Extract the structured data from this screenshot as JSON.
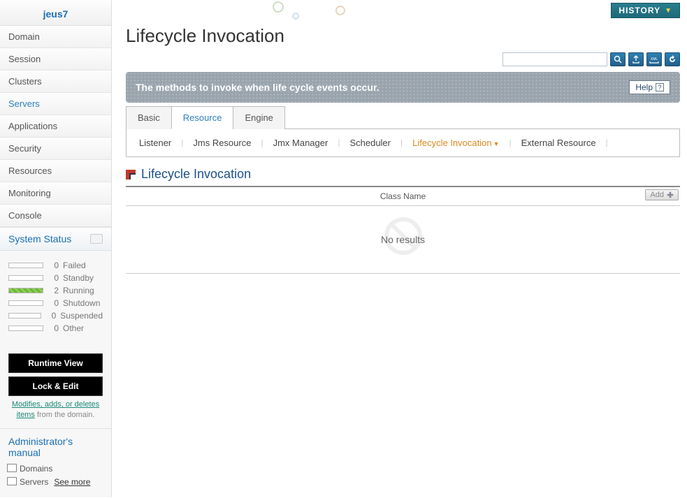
{
  "brand": "jeus7",
  "nav": {
    "items": [
      {
        "label": "Domain"
      },
      {
        "label": "Session"
      },
      {
        "label": "Clusters"
      },
      {
        "label": "Servers",
        "active": true
      },
      {
        "label": "Applications"
      },
      {
        "label": "Security"
      },
      {
        "label": "Resources"
      },
      {
        "label": "Monitoring"
      },
      {
        "label": "Console"
      }
    ]
  },
  "status": {
    "header": "System Status",
    "items": [
      {
        "count": 0,
        "label": "Failed",
        "running": false
      },
      {
        "count": 0,
        "label": "Standby",
        "running": false
      },
      {
        "count": 2,
        "label": "Running",
        "running": true
      },
      {
        "count": 0,
        "label": "Shutdown",
        "running": false
      },
      {
        "count": 0,
        "label": "Suspended",
        "running": false
      },
      {
        "count": 0,
        "label": "Other",
        "running": false
      }
    ]
  },
  "buttons": {
    "runtime": "Runtime View",
    "lock": "Lock & Edit",
    "hint_link": "Modifies, adds, or deletes items",
    "hint_tail": " from the domain."
  },
  "manual": {
    "title": "Administrator's manual",
    "items": [
      "Domains",
      "Servers"
    ],
    "see_more": "See more"
  },
  "topbar": {
    "history": "HISTORY"
  },
  "page": {
    "title": "Lifecycle Invocation",
    "banner": "The methods to invoke when life cycle events occur.",
    "help": "Help"
  },
  "search": {
    "placeholder": ""
  },
  "tabs": [
    {
      "label": "Basic"
    },
    {
      "label": "Resource",
      "active": true
    },
    {
      "label": "Engine"
    }
  ],
  "subtabs": [
    {
      "label": "Listener"
    },
    {
      "label": "Jms Resource"
    },
    {
      "label": "Jmx Manager"
    },
    {
      "label": "Scheduler"
    },
    {
      "label": "Lifecycle Invocation",
      "active": true
    },
    {
      "label": "External Resource"
    }
  ],
  "section": {
    "title": "Lifecycle Invocation",
    "column": "Class Name",
    "add": "Add",
    "empty": "No results"
  }
}
